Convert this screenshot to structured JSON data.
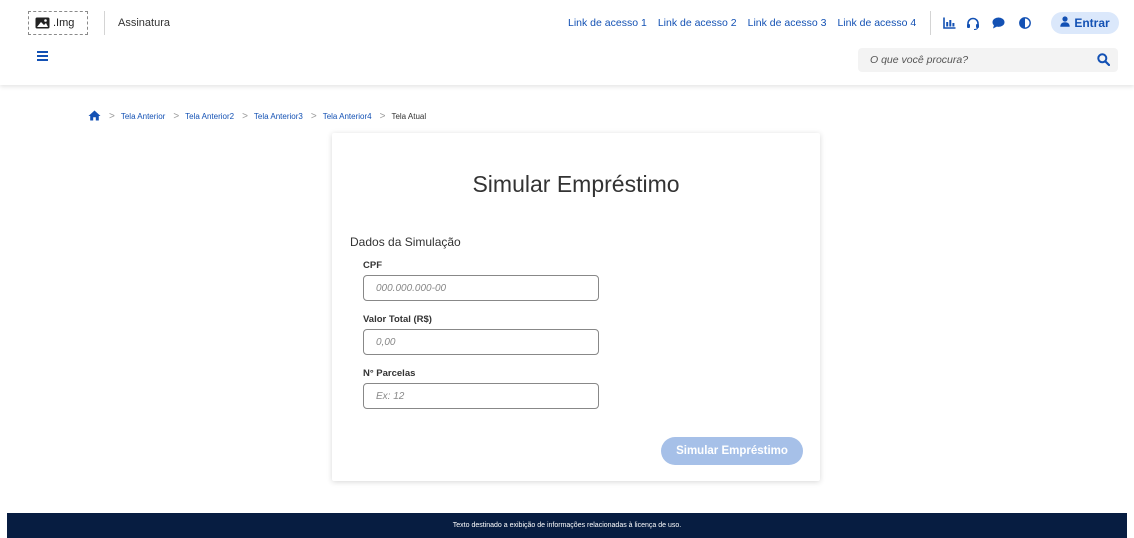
{
  "header": {
    "logo_text": ".Img",
    "signature": "Assinatura",
    "links": [
      "Link de acesso 1",
      "Link de acesso 2",
      "Link de acesso 3",
      "Link de acesso 4"
    ],
    "icons": [
      "chart-icon",
      "headset-icon",
      "chat-icon",
      "contrast-icon"
    ],
    "login_label": "Entrar",
    "search_placeholder": "O que você procura?"
  },
  "breadcrumb": {
    "items": [
      "Tela Anterior",
      "Tela Anterior2",
      "Tela Anterior3",
      "Tela Anterior4"
    ],
    "current": "Tela Atual"
  },
  "form": {
    "title": "Simular Empréstimo",
    "section_title": "Dados da Simulação",
    "fields": [
      {
        "label": "CPF",
        "placeholder": "000.000.000-00",
        "value": ""
      },
      {
        "label": "Valor Total (R$)",
        "placeholder": "0,00",
        "value": ""
      },
      {
        "label": "N° Parcelas",
        "placeholder": "Ex: 12",
        "value": ""
      }
    ],
    "submit_label": "Simular Empréstimo"
  },
  "footer": {
    "text": "Texto destinado a exibição de informações relacionadas à licença de uso."
  },
  "colors": {
    "primary": "#1351b4",
    "footer_bg": "#071d41",
    "button_disabled": "#a6c0e8",
    "login_bg": "#dbe8fb"
  }
}
